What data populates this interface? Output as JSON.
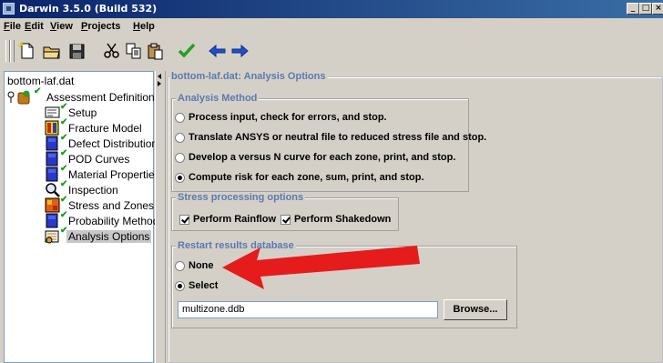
{
  "window": {
    "title": "Darwin 3.5.0 (Build 532)",
    "controls": {
      "minimize": "_",
      "maximize": "□",
      "close": "×"
    }
  },
  "menu": [
    "File",
    "Edit",
    "View",
    "Projects",
    "Help"
  ],
  "toolbar": {
    "buttons": [
      "new-file-icon",
      "open-folder-icon",
      "save-icon",
      "cut-icon",
      "copy-icon",
      "paste-icon",
      "check-icon",
      "back-arrow-icon",
      "forward-arrow-icon"
    ]
  },
  "tree": {
    "root_label": "bottom-laf.dat",
    "assessment_label": "Assessment Definition",
    "items": [
      {
        "label": "Setup",
        "icon": "setup-icon",
        "status": "checked"
      },
      {
        "label": "Fracture Model",
        "icon": "fracture-model-icon",
        "status": "checked"
      },
      {
        "label": "Defect Distribution",
        "icon": "defect-distribution-icon",
        "status": "checked"
      },
      {
        "label": "POD Curves",
        "icon": "pod-curves-icon",
        "status": "checked"
      },
      {
        "label": "Material Properties",
        "icon": "material-properties-icon",
        "status": "checked"
      },
      {
        "label": "Inspection",
        "icon": "inspection-icon",
        "status": "checked"
      },
      {
        "label": "Stress and Zones",
        "icon": "stress-zones-icon",
        "status": "checked"
      },
      {
        "label": "Probability Method",
        "icon": "probability-method-icon",
        "status": "checked"
      },
      {
        "label": "Analysis Options",
        "icon": "analysis-options-icon",
        "status": "checked",
        "selected": true
      }
    ]
  },
  "panel": {
    "title": "bottom-laf.dat: Analysis Options",
    "analysis_method": {
      "title": "Analysis Method",
      "options": [
        {
          "label": "Process input, check for errors, and stop.",
          "selected": false
        },
        {
          "label": "Translate ANSYS or neutral file to reduced stress file and stop.",
          "selected": false
        },
        {
          "label": "Develop a versus N curve for each zone, print, and stop.",
          "selected": false
        },
        {
          "label": "Compute risk for each zone, sum, print, and stop.",
          "selected": true
        }
      ]
    },
    "stress_processing": {
      "title": "Stress processing options",
      "checks": [
        {
          "label": "Perform Rainflow",
          "checked": true
        },
        {
          "label": "Perform Shakedown",
          "checked": true
        }
      ]
    },
    "restart": {
      "title": "Restart results database",
      "options": [
        {
          "label": "None",
          "selected": false
        },
        {
          "label": "Select",
          "selected": true
        }
      ],
      "database_value": "multizone.ddb",
      "browse_label": "Browse..."
    }
  },
  "colors": {
    "title_bar_start": "#0a246a",
    "title_bar_end": "#3a6ea5",
    "legend_text": "#5a7ab0",
    "annotation_arrow": "#e61b1b",
    "check_mark": "#18a018"
  }
}
